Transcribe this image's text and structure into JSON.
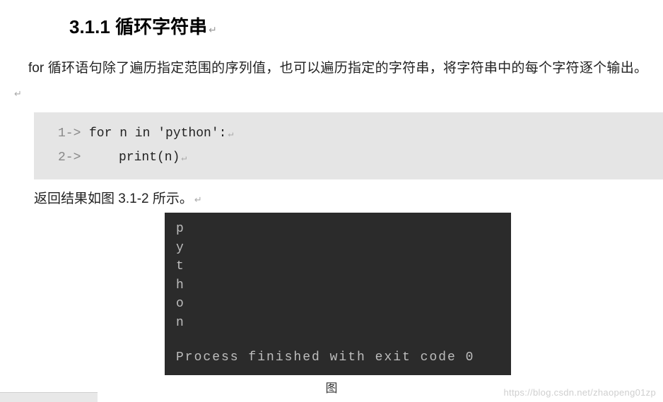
{
  "heading": {
    "number": "3.1.1",
    "title": "循环字符串"
  },
  "paragraph": "for 循环语句除了遍历指定范围的序列值，也可以遍历指定的字符串，将字符串中的每个字符逐个输出。",
  "code": {
    "lines": [
      {
        "num": "1->",
        "text": "for n in 'python':"
      },
      {
        "num": "2->",
        "text": "print(n)"
      }
    ]
  },
  "result_caption": "返回结果如图 3.1-2 所示。",
  "terminal": {
    "output_lines": [
      "p",
      "y",
      "t",
      "h",
      "o",
      "n"
    ],
    "exit_message": "Process finished with exit code 0"
  },
  "fig_cut": "图",
  "watermark": "https://blog.csdn.net/zhaopeng01zp",
  "return_glyph": "↵"
}
